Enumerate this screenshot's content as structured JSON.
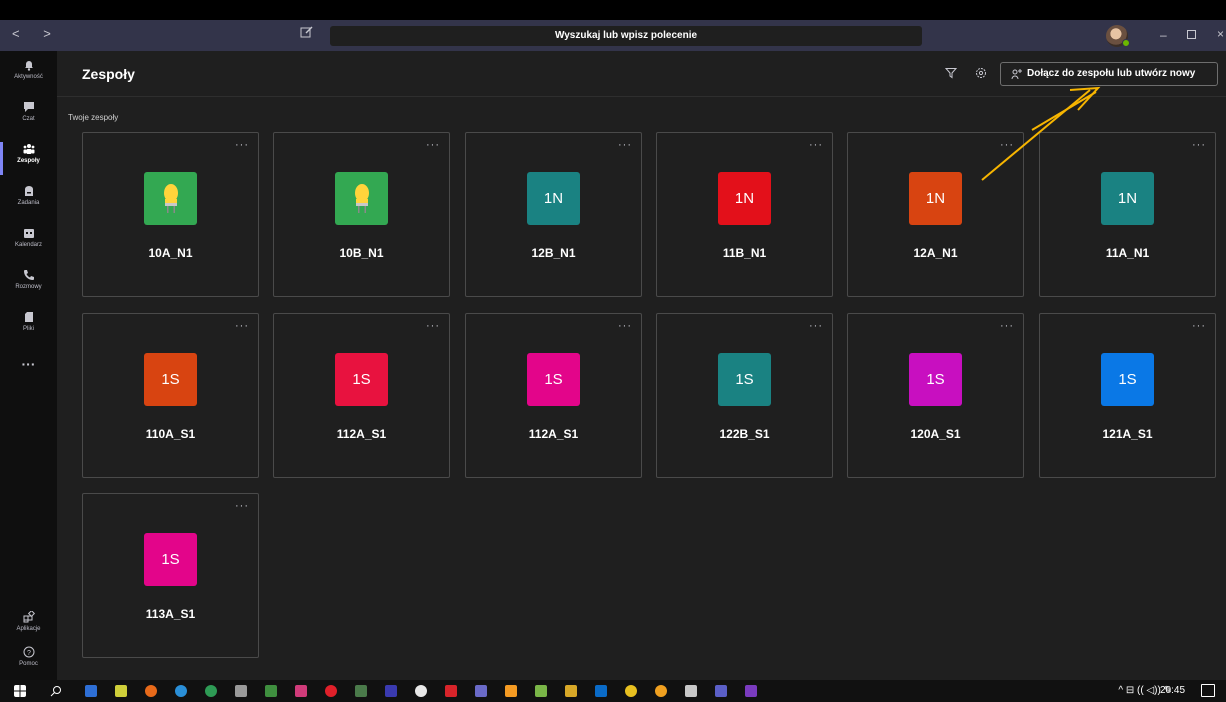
{
  "titlebar": {
    "search_placeholder": "Wyszukaj lub wpisz polecenie",
    "nav_arrows": "< >",
    "minimize": "–",
    "close": "×"
  },
  "rail": {
    "items": [
      {
        "label": "Aktywność",
        "icon": "bell-icon"
      },
      {
        "label": "Czat",
        "icon": "chat-icon"
      },
      {
        "label": "Zespoły",
        "icon": "teams-icon"
      },
      {
        "label": "Zadania",
        "icon": "assignments-icon"
      },
      {
        "label": "Kalendarz",
        "icon": "calendar-icon"
      },
      {
        "label": "Rozmowy",
        "icon": "phone-icon"
      },
      {
        "label": "Pliki",
        "icon": "files-icon"
      }
    ],
    "more": "···",
    "bottom": [
      {
        "label": "Aplikacje",
        "icon": "apps-icon"
      },
      {
        "label": "Pomoc",
        "icon": "help-icon"
      }
    ]
  },
  "header": {
    "title": "Zespoły",
    "join_button": "Dołącz do zespołu lub utwórz nowy"
  },
  "section": {
    "label": "Twoje zespoły"
  },
  "teams": [
    {
      "name": "10A_N1",
      "logo_text": "",
      "logo_type": "bulb",
      "color": "#33a852"
    },
    {
      "name": "10B_N1",
      "logo_text": "",
      "logo_type": "bulb",
      "color": "#33a852"
    },
    {
      "name": "12B_N1",
      "logo_text": "1N",
      "logo_type": "text",
      "color": "#1a8282"
    },
    {
      "name": "11B_N1",
      "logo_text": "1N",
      "logo_type": "text",
      "color": "#e3101a"
    },
    {
      "name": "12A_N1",
      "logo_text": "1N",
      "logo_type": "text",
      "color": "#d84411"
    },
    {
      "name": "11A_N1",
      "logo_text": "1N",
      "logo_type": "text",
      "color": "#1a8282"
    },
    {
      "name": "110A_S1",
      "logo_text": "1S",
      "logo_type": "text",
      "color": "#d84411"
    },
    {
      "name": "112A_S1",
      "logo_text": "1S",
      "logo_type": "text",
      "color": "#e8123f"
    },
    {
      "name": "112A_S1",
      "logo_text": "1S",
      "logo_type": "text",
      "color": "#e3058a"
    },
    {
      "name": "122B_S1",
      "logo_text": "1S",
      "logo_type": "text",
      "color": "#1a8282"
    },
    {
      "name": "120A_S1",
      "logo_text": "1S",
      "logo_type": "text",
      "color": "#c80fc0"
    },
    {
      "name": "121A_S1",
      "logo_text": "1S",
      "logo_type": "text",
      "color": "#0a78e6"
    },
    {
      "name": "113A_S1",
      "logo_text": "1S",
      "logo_type": "text",
      "color": "#e3058a"
    }
  ],
  "tile_more": "···",
  "taskbar": {
    "clock": "20:45",
    "tray": "^ ⊟ (( ◁)) ✎"
  },
  "colors": {
    "accent": "#7f85f5",
    "annotation": "#f7b500",
    "titlebar": "#33344a",
    "background": "#1f1f1f"
  }
}
